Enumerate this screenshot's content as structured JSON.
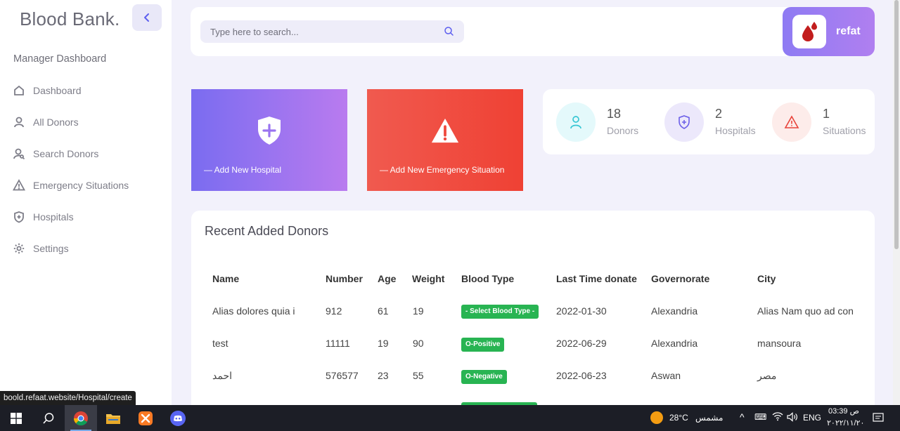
{
  "sidebar": {
    "brand": "Blood Bank.",
    "section_label": "Manager Dashboard",
    "items": [
      {
        "label": "Dashboard",
        "icon": "home-icon"
      },
      {
        "label": "All Donors",
        "icon": "user-icon"
      },
      {
        "label": "Search Donors",
        "icon": "user-search-icon"
      },
      {
        "label": "Emergency Situations",
        "icon": "warning-icon"
      },
      {
        "label": "Hospitals",
        "icon": "shield-plus-icon"
      },
      {
        "label": "Settings",
        "icon": "gear-icon"
      }
    ]
  },
  "header": {
    "search_placeholder": "Type here to search...",
    "username": "refat"
  },
  "actions": {
    "add_hospital": "— Add New Hospital",
    "add_emergency": "— Add New Emergency Situation"
  },
  "stats": {
    "donors": {
      "value": "18",
      "label": "Donors"
    },
    "hospitals": {
      "value": "2",
      "label": "Hospitals"
    },
    "situations": {
      "value": "1",
      "label": "Situations"
    }
  },
  "table": {
    "title": "Recent Added Donors",
    "columns": [
      "Name",
      "Number",
      "Age",
      "Weight",
      "Blood Type",
      "Last Time donate",
      "Governorate",
      "City"
    ],
    "rows": [
      {
        "name": "Alias dolores quia i",
        "number": "912",
        "age": "61",
        "weight": "19",
        "blood_type": "- Select Blood Type -",
        "last_donate": "2022-01-30",
        "governorate": "Alexandria",
        "city": "Alias Nam quo ad con"
      },
      {
        "name": "test",
        "number": "11111",
        "age": "19",
        "weight": "90",
        "blood_type": "O-Positive",
        "last_donate": "2022-06-29",
        "governorate": "Alexandria",
        "city": "mansoura"
      },
      {
        "name": "احمد",
        "number": "576577",
        "age": "23",
        "weight": "55",
        "blood_type": "O-Negative",
        "last_donate": "2022-06-23",
        "governorate": "Aswan",
        "city": "مصر"
      }
    ]
  },
  "status_url": "boold.refaat.website/Hospital/create",
  "taskbar": {
    "weather_temp": "28°C",
    "weather_label": "مشمس",
    "lang": "ENG",
    "time": "03:39 ص",
    "date": "٢٠٢٢/١١/٢٠"
  },
  "colors": {
    "accent": "#5d5fef",
    "hospital_card": "#9a74f0",
    "emergency_card": "#ef4a3e",
    "badge": "#28b452"
  }
}
